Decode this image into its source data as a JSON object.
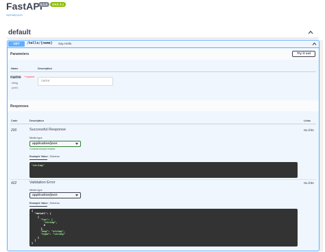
{
  "header": {
    "title": "FastAPI",
    "version_badge": "0.1.0",
    "oas_badge": "OAS 3.1",
    "openapi_link": "/openapi.json"
  },
  "tag": {
    "name": "default"
  },
  "operation": {
    "method": "GET",
    "path": "/hello/{name}",
    "summary": "Say Hello",
    "parameters_title": "Parameters",
    "try_button": "Try it out",
    "param_headers": {
      "name": "Name",
      "description": "Description"
    },
    "param": {
      "name": "name",
      "required": "* required",
      "type": "string",
      "in": "(path)",
      "placeholder": "name"
    },
    "responses_title": "Responses",
    "resp_headers": {
      "code": "Code",
      "description": "Description",
      "links": "Links"
    },
    "responses": [
      {
        "code": "200",
        "description": "Successful Response",
        "links": "No links",
        "media_type_label": "Media type",
        "media_type": "application/json",
        "controls_note": "Controls Accept header.",
        "example_tab": "Example Value",
        "schema_tab": "Schema",
        "example": "\"string\""
      },
      {
        "code": "422",
        "description": "Validation Error",
        "links": "No links",
        "media_type_label": "Media type",
        "media_type": "application/json",
        "example_tab": "Example Value",
        "schema_tab": "Schema",
        "example_lines": [
          "{",
          "  \"detail\": [",
          "    {",
          "      \"loc\": [",
          "        \"string\",",
          "        0",
          "      ],",
          "      \"msg\": \"string\",",
          "      \"type\": \"string\"",
          "    }",
          "  ]",
          "}"
        ]
      }
    ]
  },
  "colors": {
    "get_accent": "#61affe",
    "version_badge": "#7d8492",
    "oas_badge": "#89bf04",
    "code_bg": "#333333",
    "required": "#ff3636"
  }
}
